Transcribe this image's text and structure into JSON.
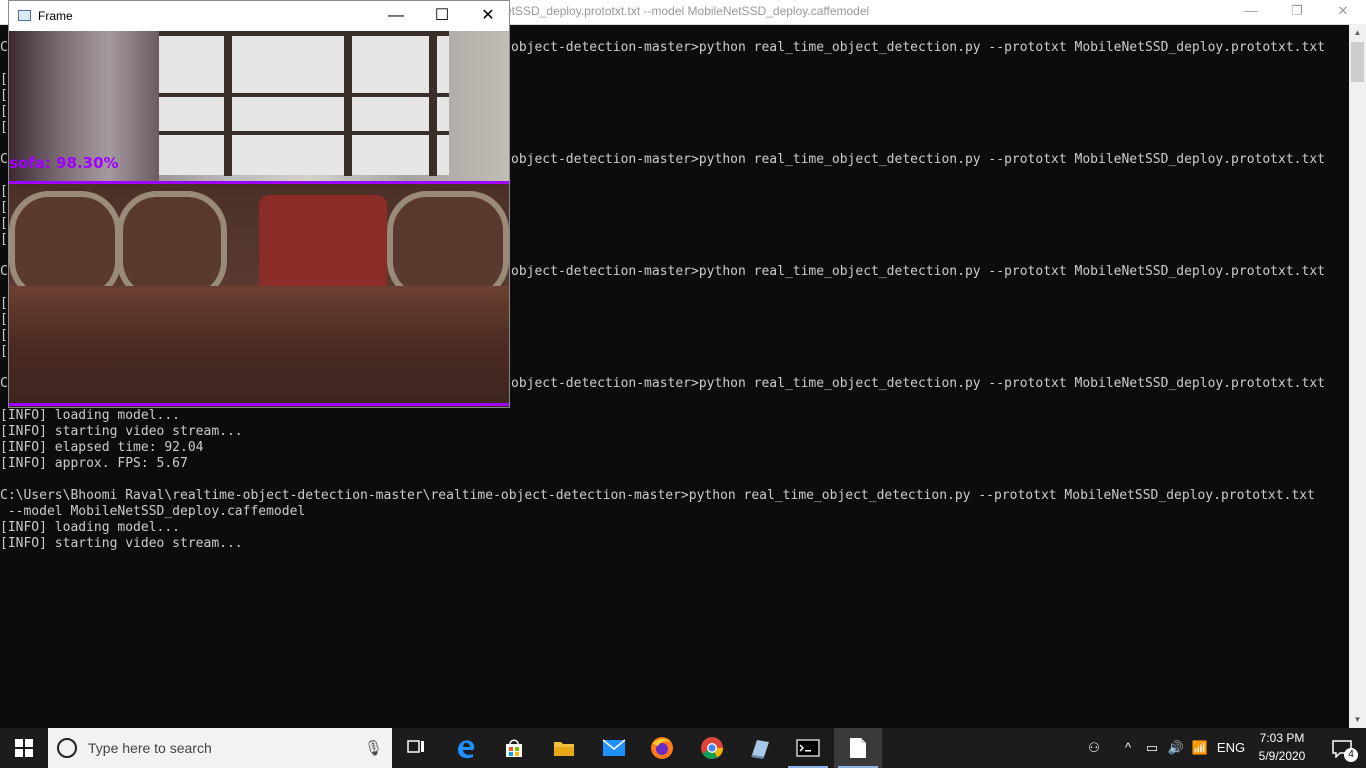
{
  "cmd_window": {
    "title": "etSSD_deploy.prototxt.txt --model MobileNetSSD_deploy.caffemodel",
    "controls": {
      "minimize": "—",
      "restore": "❐",
      "close": "✕"
    },
    "lines": [
      "C",
      "",
      "[",
      "[",
      "[",
      "[",
      "",
      "C",
      "",
      "[",
      "[",
      "[",
      "[",
      "",
      "C",
      "",
      "[",
      "[",
      "[",
      "[",
      "",
      "C",
      "[INFO] loading model...",
      "[INFO] starting video stream...",
      "[INFO] elapsed time: 92.04",
      "[INFO] approx. FPS: 5.67",
      "",
      "C:\\Users\\Bhoomi Raval\\realtime-object-detection-master\\realtime-object-detection-master>python real_time_object_detection.py --prototxt MobileNetSSD_deploy.prototxt.txt",
      " --model MobileNetSSD_deploy.caffemodel",
      "[INFO] loading model...",
      "[INFO] starting video stream..."
    ],
    "partial_command": "object-detection-master>python real_time_object_detection.py --prototxt MobileNetSSD_deploy.prototxt.txt"
  },
  "frame_window": {
    "title": "Frame",
    "detection_label": "sofa: 98.30%",
    "controls": {
      "minimize": "—",
      "maximize": "☐",
      "close": "✕"
    }
  },
  "taskbar": {
    "search_placeholder": "Type here to search",
    "language": "ENG",
    "time": "7:03 PM",
    "date": "5/9/2020",
    "notification_count": "4"
  },
  "colors": {
    "detection": "#a000ff",
    "console_bg": "#0c0c0c",
    "console_text": "#cccccc",
    "taskbar": "#1c1c1c"
  }
}
